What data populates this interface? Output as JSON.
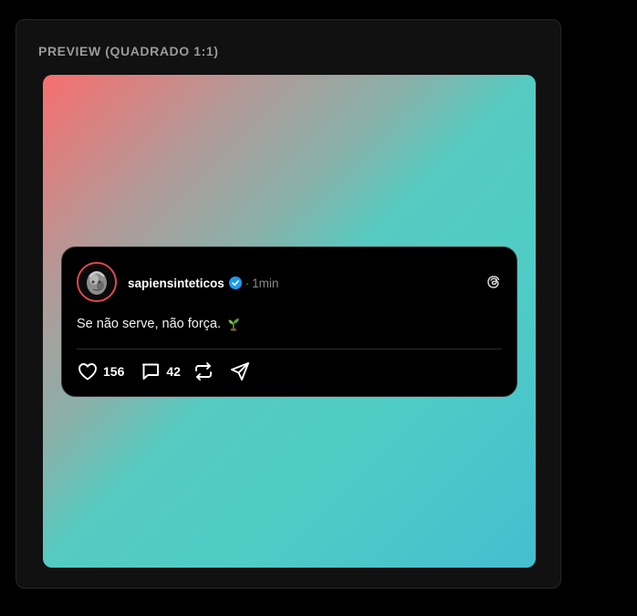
{
  "panel": {
    "title": "PREVIEW (QUADRADO 1:1)"
  },
  "canvas": {
    "gradient_colors": [
      "#f86e6e",
      "#4fccc5",
      "#45bed0"
    ]
  },
  "post": {
    "username": "sapiensinteticos",
    "verified_icon": "verified-badge-icon",
    "separator": "·",
    "time": "1min",
    "platform_icon": "threads-logo-icon",
    "text": "Se não serve, não força.",
    "emoji_icon": "seedling-icon",
    "actions": {
      "likes": "156",
      "comments": "42",
      "repost_icon": "repost-icon",
      "share_icon": "send-icon"
    }
  },
  "colors": {
    "accent_verified": "#1d9bf0",
    "avatar_ring": "#e04852",
    "card_bg": "#000000"
  }
}
